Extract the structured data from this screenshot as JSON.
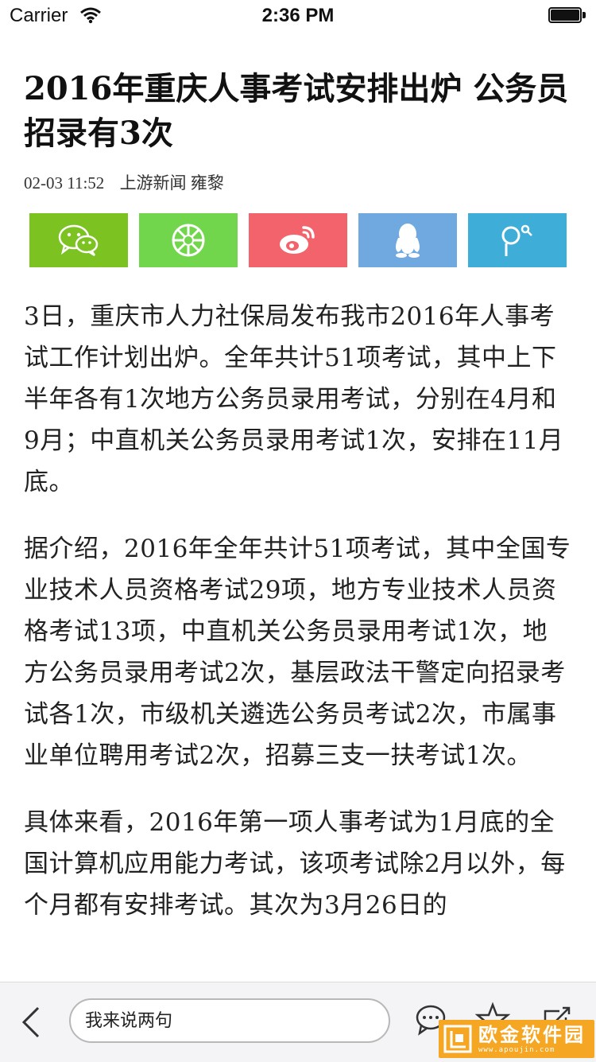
{
  "status_bar": {
    "carrier": "Carrier",
    "time": "2:36 PM"
  },
  "article": {
    "title": "2016年重庆人事考试安排出炉 公务员招录有3次",
    "date": "02-03 11:52",
    "source": "上游新闻 雍黎",
    "paragraphs": [
      "3日，重庆市人力社保局发布我市2016年人事考试工作计划出炉。全年共计51项考试，其中上下半年各有1次地方公务员录用考试，分别在4月和9月；中直机关公务员录用考试1次，安排在11月底。",
      "据介绍，2016年全年共计51项考试，其中全国专业技术人员资格考试29项，地方专业技术人员资格考试13项，中直机关公务员录用考试1次，地方公务员录用考试2次，基层政法干警定向招录考试各1次，市级机关遴选公务员考试2次，市属事业单位聘用考试2次，招募三支一扶考试1次。",
      "具体来看，2016年第一项人事考试为1月底的全国计算机应用能力考试，该项考试除2月以外，每个月都有安排考试。其次为3月26日的"
    ]
  },
  "share": {
    "buttons": [
      {
        "name": "wechat",
        "color": "#7cc322",
        "icon": "wechat-icon"
      },
      {
        "name": "moments",
        "color": "#72d64d",
        "icon": "moments-icon"
      },
      {
        "name": "weibo",
        "color": "#f2636b",
        "icon": "weibo-icon"
      },
      {
        "name": "qq",
        "color": "#6fa9e0",
        "icon": "qq-icon"
      },
      {
        "name": "other",
        "color": "#3eaed8",
        "icon": "share-other-icon"
      }
    ]
  },
  "bottom_bar": {
    "comment_placeholder": "我来说两句"
  },
  "watermark": {
    "text": "欧金软件园",
    "sub": "www.apoujin.com"
  }
}
